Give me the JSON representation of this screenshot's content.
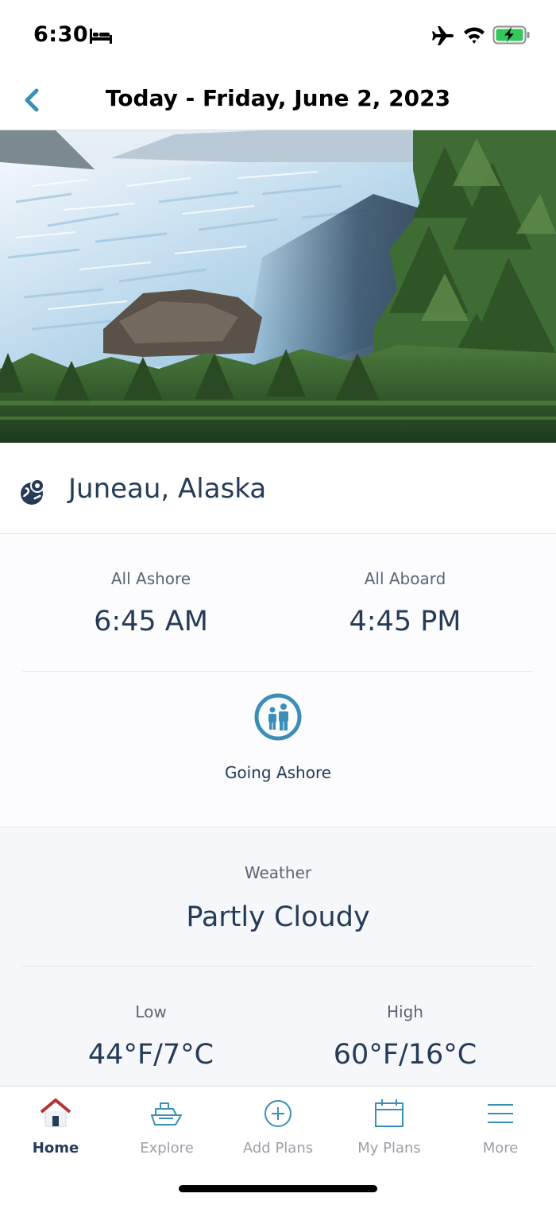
{
  "status_bar": {
    "time": "6:30",
    "icons": [
      "bed-icon",
      "airplane-icon",
      "wifi-icon",
      "battery-charging-icon"
    ]
  },
  "nav": {
    "title": "Today - Friday, June 2, 2023",
    "back_icon": "chevron-left-icon"
  },
  "hero": {
    "icon": "glacier-photo"
  },
  "location": {
    "name": "Juneau, Alaska",
    "icon": "globe-pin-icon"
  },
  "times": {
    "ashore_label": "All Ashore",
    "ashore_time": "6:45 AM",
    "aboard_label": "All Aboard",
    "aboard_time": "4:45 PM",
    "going_ashore_label": "Going Ashore",
    "going_ashore_icon": "family-icon"
  },
  "weather": {
    "label": "Weather",
    "condition": "Partly Cloudy",
    "low_label": "Low",
    "low_value": "44°F/7°C",
    "high_label": "High",
    "high_value": "60°F/16°C"
  },
  "tabs": [
    {
      "label": "Home",
      "icon": "home-icon",
      "active": true
    },
    {
      "label": "Explore",
      "icon": "ship-icon",
      "active": false
    },
    {
      "label": "Add Plans",
      "icon": "plus-circle-icon",
      "active": false
    },
    {
      "label": "My Plans",
      "icon": "calendar-icon",
      "active": false
    },
    {
      "label": "More",
      "icon": "menu-icon",
      "active": false
    }
  ],
  "colors": {
    "accent": "#3a8fb7",
    "text_primary": "#253b56",
    "text_secondary": "#5b6573",
    "tab_inactive": "#9aa0a8",
    "home_icon_roof": "#c0392b"
  }
}
